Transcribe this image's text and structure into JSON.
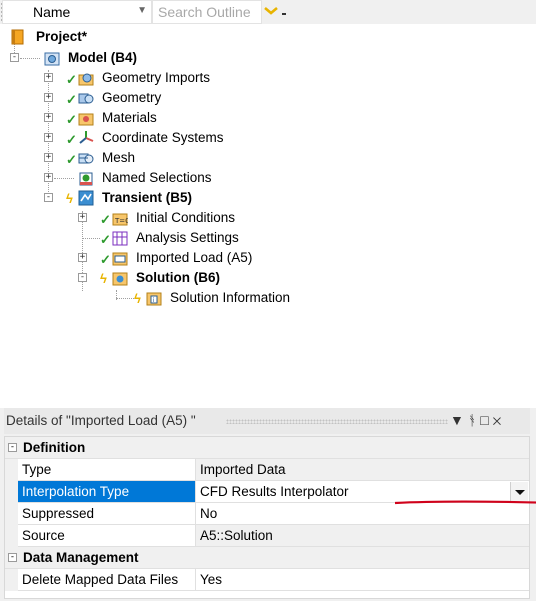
{
  "toolbar": {
    "name_label": "Name",
    "search_placeholder": "Search Outline"
  },
  "tree": {
    "project": "Project*",
    "model": "Model (B4)",
    "geometry_imports": "Geometry Imports",
    "geometry": "Geometry",
    "materials": "Materials",
    "coordinate_systems": "Coordinate Systems",
    "mesh": "Mesh",
    "named_selections": "Named Selections",
    "transient": "Transient (B5)",
    "initial_conditions": "Initial Conditions",
    "analysis_settings": "Analysis Settings",
    "imported_load": "Imported Load (A5)",
    "solution": "Solution (B6)",
    "solution_information": "Solution Information"
  },
  "details": {
    "title": "Details of \"Imported Load (A5) \"",
    "window_buttons": [
      "▼",
      "ᚬ",
      "□",
      "✕"
    ],
    "categories": [
      {
        "title": "Definition",
        "rows": [
          {
            "name": "Type",
            "value": "Imported Data"
          },
          {
            "name": "Interpolation Type",
            "value": "CFD Results Interpolator"
          },
          {
            "name": "Suppressed",
            "value": "No"
          },
          {
            "name": "Source",
            "value": "A5::Solution"
          }
        ]
      },
      {
        "title": "Data Management",
        "rows": [
          {
            "name": "Delete Mapped Data Files",
            "value": "Yes"
          }
        ]
      }
    ]
  },
  "colors": {
    "selection": "#0078d7",
    "annotation_underline": "#d0021b",
    "check": "#2e9a2e",
    "bolt": "#e8b400"
  }
}
